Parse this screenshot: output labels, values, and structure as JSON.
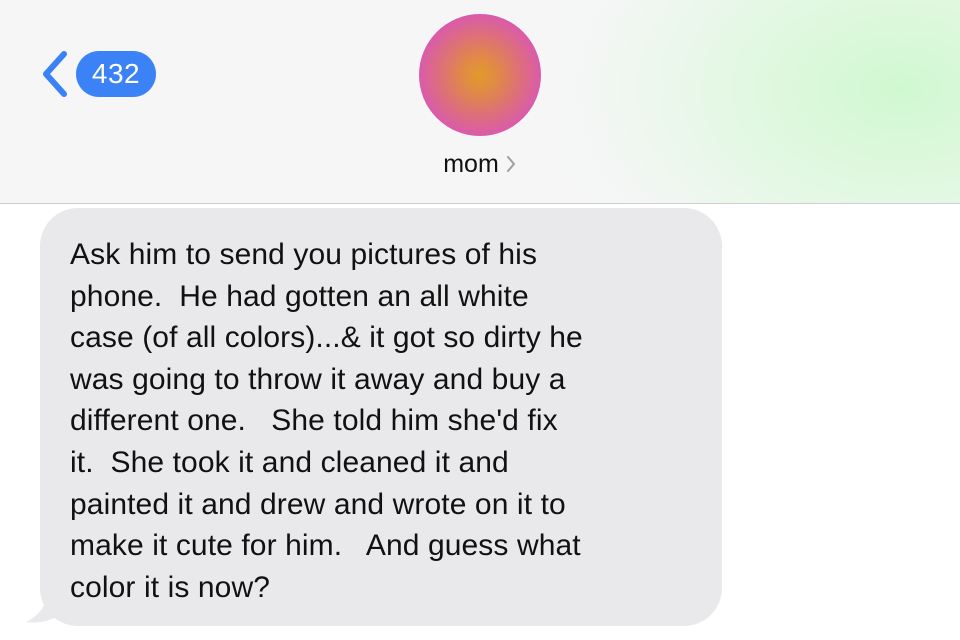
{
  "header": {
    "back_badge_count": "432",
    "contact_name": "mom",
    "avatar_icon": "contact-avatar",
    "colors": {
      "badge": "#3a82f6",
      "avatar_center": "#e39a2c",
      "avatar_edge": "#d652b6",
      "header_bg": "#f6f6f7",
      "header_glow": "#d8f7d8"
    }
  },
  "messages": [
    {
      "direction": "incoming",
      "bubble_color": "#e9e9eb",
      "lines": [
        "Ask him to send you pictures of his",
        "phone.  He had gotten an all white",
        "case (of all colors)...& it got so dirty he",
        "was going to throw it away and buy a",
        "different one.   She told him she'd fix",
        "it.  She took it and cleaned it and",
        "painted it and drew and wrote on it to",
        "make it cute for him.   And guess what",
        "color it is now?"
      ]
    }
  ]
}
